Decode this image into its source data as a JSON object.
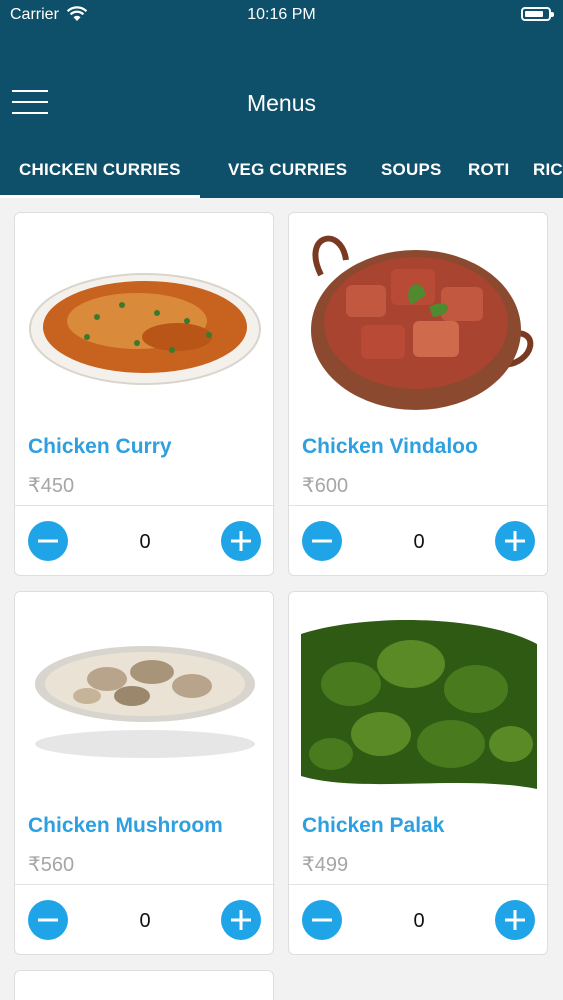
{
  "status_bar": {
    "carrier": "Carrier",
    "time": "10:16 PM"
  },
  "nav": {
    "title": "Menus"
  },
  "tabs": [
    {
      "label": "CHICKEN CURRIES"
    },
    {
      "label": "VEG CURRIES"
    },
    {
      "label": "SOUPS"
    },
    {
      "label": "ROTI"
    },
    {
      "label": "RIC"
    }
  ],
  "items": [
    {
      "name": "Chicken Curry",
      "price": "₹450",
      "qty": "0",
      "image_icon": "chicken-curry-plate-image"
    },
    {
      "name": "Chicken Vindaloo",
      "price": "₹600",
      "qty": "0",
      "image_icon": "vindaloo-kadai-image"
    },
    {
      "name": "Chicken Mushroom",
      "price": "₹560",
      "qty": "0",
      "image_icon": "mushroom-bowl-image"
    },
    {
      "name": "Chicken Palak",
      "price": "₹499",
      "qty": "0",
      "image_icon": "palak-curry-image"
    }
  ],
  "colors": {
    "header": "#0e4f69",
    "accent": "#2e9fe0",
    "button": "#1fa4e8",
    "price": "#a6a6a6"
  }
}
